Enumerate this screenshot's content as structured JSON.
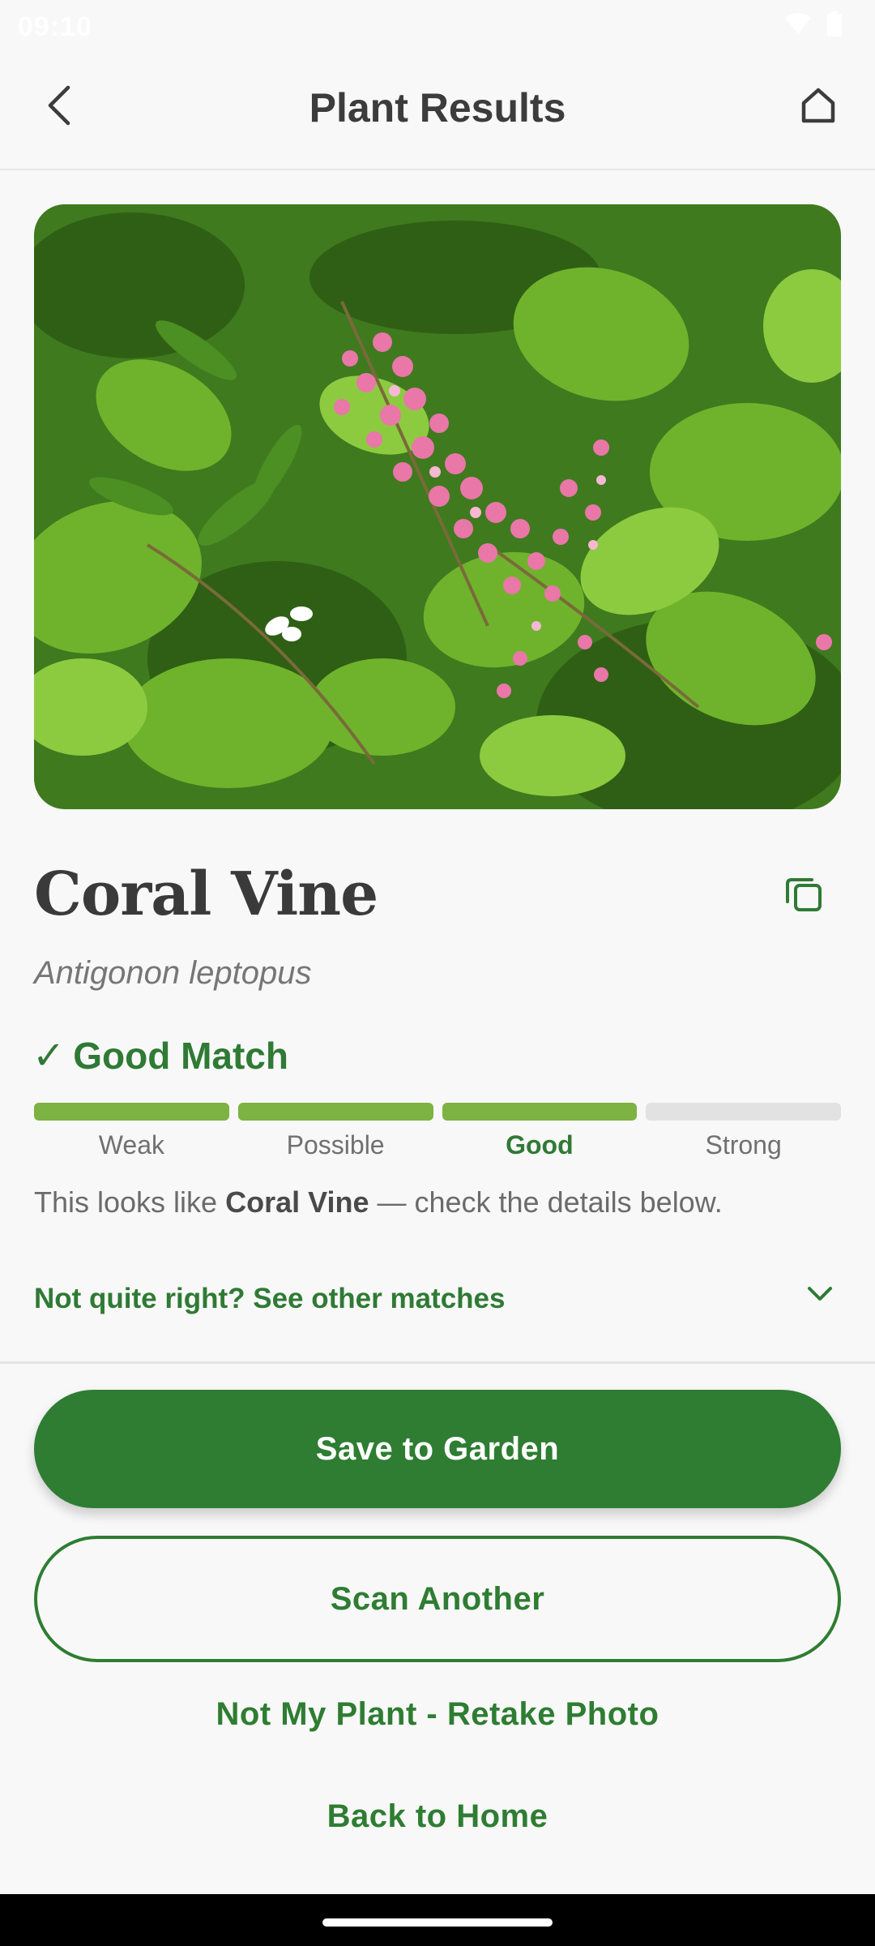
{
  "status_bar": {
    "time": "09:10"
  },
  "header": {
    "title": "Plant Results",
    "back_icon": "chevron-left-icon",
    "home_icon": "home-icon"
  },
  "plant": {
    "common_name": "Coral Vine",
    "scientific_name": "Antigonon leptopus",
    "copy_icon": "copy-icon"
  },
  "match": {
    "label": "Good Match",
    "check": "✓",
    "levels": [
      "Weak",
      "Possible",
      "Good",
      "Strong"
    ],
    "active_level": "Good",
    "filled_segments": 3,
    "total_segments": 4,
    "description_prefix": "This looks like ",
    "description_name": "Coral Vine",
    "description_suffix": " — check the details below."
  },
  "other_matches": {
    "label": "Not quite right? See other matches"
  },
  "actions": {
    "save_label": "Save to Garden",
    "scan_label": "Scan Another",
    "retake_label": "Not My Plant - Retake Photo",
    "home_label": "Back to Home"
  },
  "colors": {
    "accent": "#2e7d32",
    "match_fill": "#7cb342",
    "match_empty": "#e2e2e2",
    "background": "#f8f8f8"
  }
}
